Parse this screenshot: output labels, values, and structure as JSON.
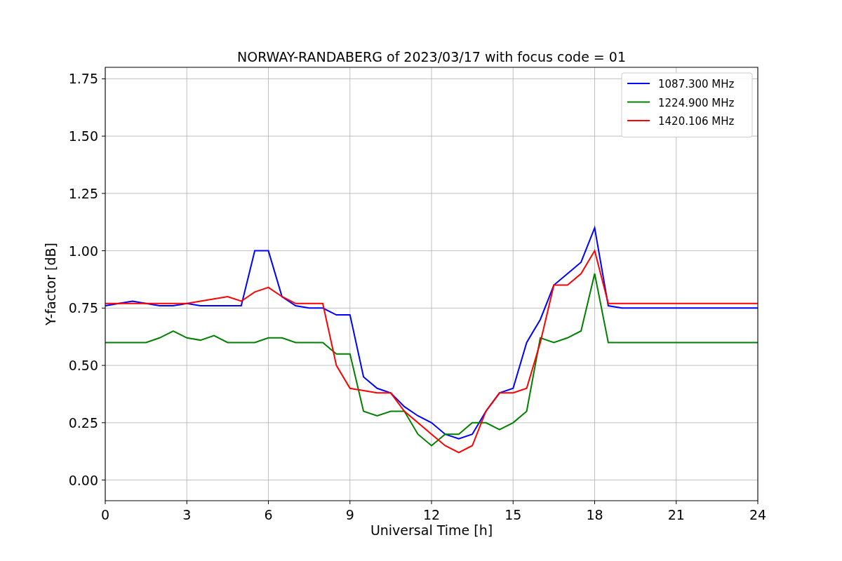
{
  "figure": {
    "chart_data": {
      "type": "line",
      "title": "NORWAY-RANDABERG of 2023/03/17 with focus code = 01",
      "xlabel": "Universal Time [h]",
      "ylabel": "Y-factor [dB]",
      "x": [
        0,
        0.5,
        1,
        1.5,
        2,
        2.5,
        3,
        3.5,
        4,
        4.5,
        5,
        5.5,
        6,
        6.5,
        7,
        7.5,
        8,
        8.5,
        9,
        9.5,
        10,
        10.5,
        11,
        11.5,
        12,
        12.5,
        13,
        13.5,
        14,
        14.5,
        15,
        15.5,
        16,
        16.5,
        17,
        17.5,
        18,
        18.5,
        19,
        19.5,
        20,
        20.5,
        21,
        21.5,
        22,
        22.5,
        23,
        23.5,
        24
      ],
      "series": [
        {
          "name": "1087.300 MHz",
          "color": "#0000ff",
          "values": [
            0.76,
            0.77,
            0.78,
            0.77,
            0.76,
            0.76,
            0.77,
            0.76,
            0.76,
            0.76,
            0.76,
            1.0,
            1.0,
            0.8,
            0.76,
            0.75,
            0.75,
            0.72,
            0.72,
            0.45,
            0.4,
            0.38,
            0.32,
            0.28,
            0.25,
            0.2,
            0.18,
            0.2,
            0.3,
            0.38,
            0.4,
            0.6,
            0.7,
            0.85,
            0.9,
            0.95,
            1.1,
            0.76,
            0.75,
            0.75,
            0.75,
            0.75,
            0.75,
            0.75,
            0.75,
            0.75,
            0.75,
            0.75,
            0.75
          ]
        },
        {
          "name": "1224.900 MHz",
          "color": "#008000",
          "values": [
            0.6,
            0.6,
            0.6,
            0.6,
            0.62,
            0.65,
            0.62,
            0.61,
            0.63,
            0.6,
            0.6,
            0.6,
            0.62,
            0.62,
            0.6,
            0.6,
            0.6,
            0.55,
            0.55,
            0.3,
            0.28,
            0.3,
            0.3,
            0.2,
            0.15,
            0.2,
            0.2,
            0.25,
            0.25,
            0.22,
            0.25,
            0.3,
            0.62,
            0.6,
            0.62,
            0.65,
            0.9,
            0.6,
            0.6,
            0.6,
            0.6,
            0.6,
            0.6,
            0.6,
            0.6,
            0.6,
            0.6,
            0.6,
            0.6
          ]
        },
        {
          "name": "1420.106 MHz",
          "color": "#ff0000",
          "values": [
            0.77,
            0.77,
            0.77,
            0.77,
            0.77,
            0.77,
            0.77,
            0.78,
            0.79,
            0.8,
            0.78,
            0.82,
            0.84,
            0.8,
            0.77,
            0.77,
            0.77,
            0.5,
            0.4,
            0.39,
            0.38,
            0.38,
            0.3,
            0.25,
            0.2,
            0.15,
            0.12,
            0.15,
            0.3,
            0.38,
            0.38,
            0.4,
            0.6,
            0.85,
            0.85,
            0.9,
            1.0,
            0.77,
            0.77,
            0.77,
            0.77,
            0.77,
            0.77,
            0.77,
            0.77,
            0.77,
            0.77,
            0.77,
            0.77
          ]
        }
      ],
      "grid": true,
      "legend": true,
      "xlim": [
        0,
        24
      ],
      "ylim": [
        -0.09,
        1.8
      ],
      "xticks": [
        0,
        3,
        6,
        9,
        12,
        15,
        18,
        21,
        24
      ],
      "yticks": [
        {
          "value": 0,
          "label": "0.00"
        },
        {
          "value": 0.25,
          "label": "0.25"
        },
        {
          "value": 0.5,
          "label": "0.50"
        },
        {
          "value": 0.75,
          "label": "0.75"
        },
        {
          "value": 1,
          "label": "1.00"
        },
        {
          "value": 1.25,
          "label": "1.25"
        },
        {
          "value": 1.5,
          "label": "1.50"
        },
        {
          "value": 1.75,
          "label": "1.75"
        }
      ]
    }
  }
}
